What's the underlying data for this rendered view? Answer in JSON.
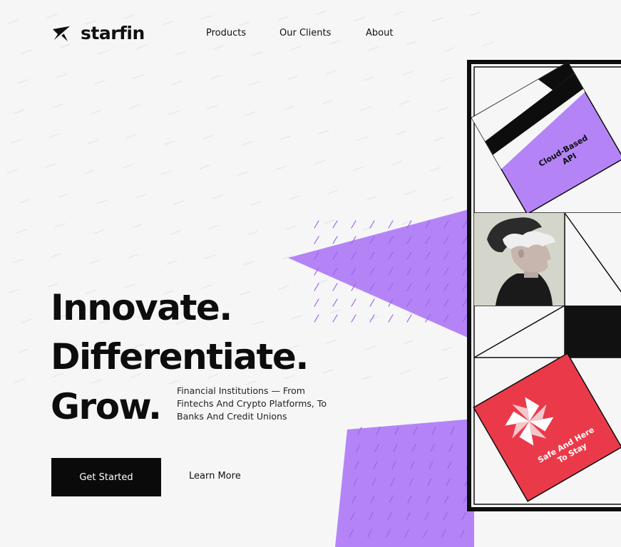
{
  "brand": {
    "name": "starfin",
    "logo_icon": "star-slash-icon"
  },
  "nav": {
    "items": [
      "Products",
      "Our Clients",
      "About"
    ]
  },
  "hero": {
    "lines": [
      "Innovate.",
      "Differentiate.",
      "Grow."
    ],
    "description": "Financial Institutions — From Fintechs And Crypto Platforms, To Banks And Credit Unions",
    "primary_cta": "Get Started",
    "secondary_cta": "Learn More"
  },
  "panel": {
    "card_top": "Cloud-Based API",
    "card_bottom": "Safe And Here To Stay"
  },
  "colors": {
    "purple": "#b484f7",
    "black": "#0d0d0d",
    "red": "#ea3a4a",
    "background": "#f6f6f6"
  }
}
